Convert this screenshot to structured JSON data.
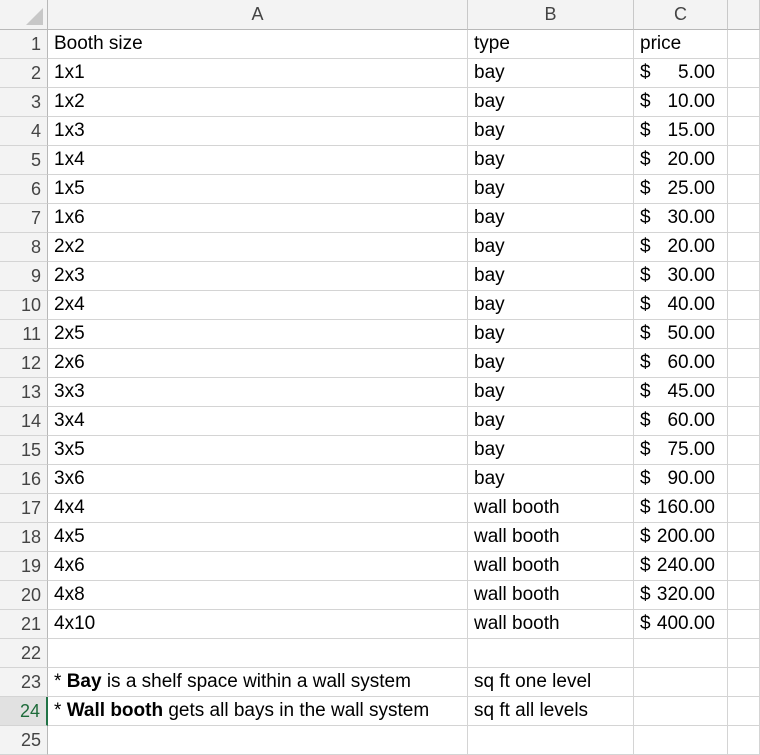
{
  "columns": [
    "A",
    "B",
    "C"
  ],
  "rows": [
    {
      "n": "1",
      "a": "Booth size",
      "b": "type",
      "c": "price",
      "header": true
    },
    {
      "n": "2",
      "a": "1x1",
      "b": "bay",
      "cur": "$",
      "amt": "5.00"
    },
    {
      "n": "3",
      "a": "1x2",
      "b": "bay",
      "cur": "$",
      "amt": "10.00"
    },
    {
      "n": "4",
      "a": "1x3",
      "b": "bay",
      "cur": "$",
      "amt": "15.00"
    },
    {
      "n": "5",
      "a": "1x4",
      "b": "bay",
      "cur": "$",
      "amt": "20.00"
    },
    {
      "n": "6",
      "a": "1x5",
      "b": "bay",
      "cur": "$",
      "amt": "25.00"
    },
    {
      "n": "7",
      "a": "1x6",
      "b": "bay",
      "cur": "$",
      "amt": "30.00"
    },
    {
      "n": "8",
      "a": "2x2",
      "b": "bay",
      "cur": "$",
      "amt": "20.00"
    },
    {
      "n": "9",
      "a": "2x3",
      "b": "bay",
      "cur": "$",
      "amt": "30.00"
    },
    {
      "n": "10",
      "a": "2x4",
      "b": "bay",
      "cur": "$",
      "amt": "40.00"
    },
    {
      "n": "11",
      "a": "2x5",
      "b": "bay",
      "cur": "$",
      "amt": "50.00"
    },
    {
      "n": "12",
      "a": "2x6",
      "b": "bay",
      "cur": "$",
      "amt": "60.00"
    },
    {
      "n": "13",
      "a": "3x3",
      "b": "bay",
      "cur": "$",
      "amt": "45.00"
    },
    {
      "n": "14",
      "a": "3x4",
      "b": "bay",
      "cur": "$",
      "amt": "60.00"
    },
    {
      "n": "15",
      "a": "3x5",
      "b": "bay",
      "cur": "$",
      "amt": "75.00"
    },
    {
      "n": "16",
      "a": "3x6",
      "b": "bay",
      "cur": "$",
      "amt": "90.00"
    },
    {
      "n": "17",
      "a": "4x4",
      "b": "wall booth",
      "cur": "$",
      "amt": "160.00"
    },
    {
      "n": "18",
      "a": "4x5",
      "b": "wall booth",
      "cur": "$",
      "amt": "200.00"
    },
    {
      "n": "19",
      "a": "4x6",
      "b": "wall booth",
      "cur": "$",
      "amt": "240.00"
    },
    {
      "n": "20",
      "a": "4x8",
      "b": "wall booth",
      "cur": "$",
      "amt": "320.00"
    },
    {
      "n": "21",
      "a": "4x10",
      "b": "wall booth",
      "cur": "$",
      "amt": "400.00"
    },
    {
      "n": "22",
      "a": "",
      "b": ""
    },
    {
      "n": "23",
      "a_prefix": "* ",
      "a_bold": "Bay",
      "a_suffix": " is a shelf space within a wall system",
      "b": "sq ft one level",
      "rich": true
    },
    {
      "n": "24",
      "a_prefix": "* ",
      "a_bold": "Wall booth",
      "a_suffix": " gets all bays in the wall system",
      "b": "sq ft all levels",
      "rich": true,
      "active": true
    },
    {
      "n": "25",
      "a": "",
      "b": ""
    }
  ]
}
